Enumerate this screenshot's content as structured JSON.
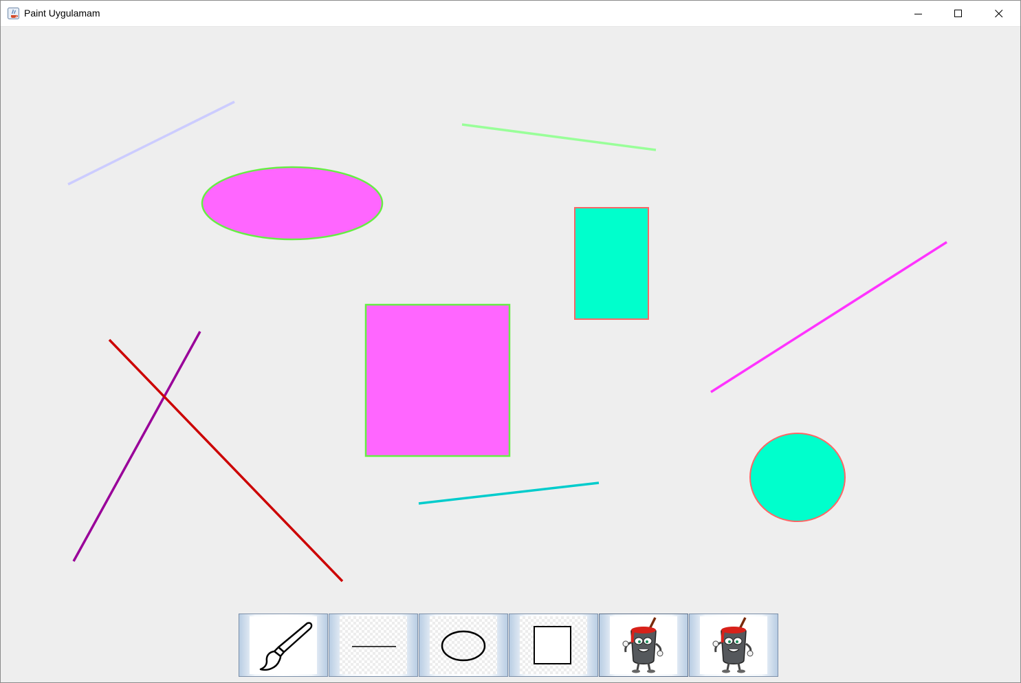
{
  "window": {
    "title": "Paint Uygulamam",
    "controls": [
      "minimize",
      "maximize",
      "close"
    ]
  },
  "canvas": {
    "background": "#eeeeee",
    "shapes": [
      {
        "kind": "line",
        "name": "lavender-line",
        "stroke": "#ccccff"
      },
      {
        "kind": "line",
        "name": "light-green-line",
        "stroke": "#99ff99"
      },
      {
        "kind": "ellipse",
        "name": "magenta-ellipse",
        "fill": "#ff66ff",
        "stroke": "#66ee44"
      },
      {
        "kind": "rectangle",
        "name": "cyan-rectangle",
        "fill": "#00ffcc",
        "stroke": "#ff6666"
      },
      {
        "kind": "line",
        "name": "magenta-line",
        "stroke": "#ff33ff"
      },
      {
        "kind": "rectangle",
        "name": "magenta-square",
        "fill": "#ff66ff",
        "stroke": "#66ee44"
      },
      {
        "kind": "line",
        "name": "purple-line",
        "stroke": "#990099"
      },
      {
        "kind": "line",
        "name": "red-line",
        "stroke": "#cc0000"
      },
      {
        "kind": "line",
        "name": "teal-line",
        "stroke": "#00cccc"
      },
      {
        "kind": "ellipse",
        "name": "cyan-circle",
        "fill": "#00ffcc",
        "stroke": "#ff6666"
      }
    ]
  },
  "toolbar": {
    "tools": [
      {
        "id": "brush",
        "icon": "paintbrush-icon"
      },
      {
        "id": "line",
        "icon": "line-icon"
      },
      {
        "id": "ellipse",
        "icon": "ellipse-icon"
      },
      {
        "id": "rectangle",
        "icon": "rectangle-icon"
      },
      {
        "id": "fill-color",
        "icon": "paint-bucket-character-icon",
        "selected": true
      },
      {
        "id": "stroke-color",
        "icon": "paint-bucket-character-icon"
      }
    ]
  }
}
